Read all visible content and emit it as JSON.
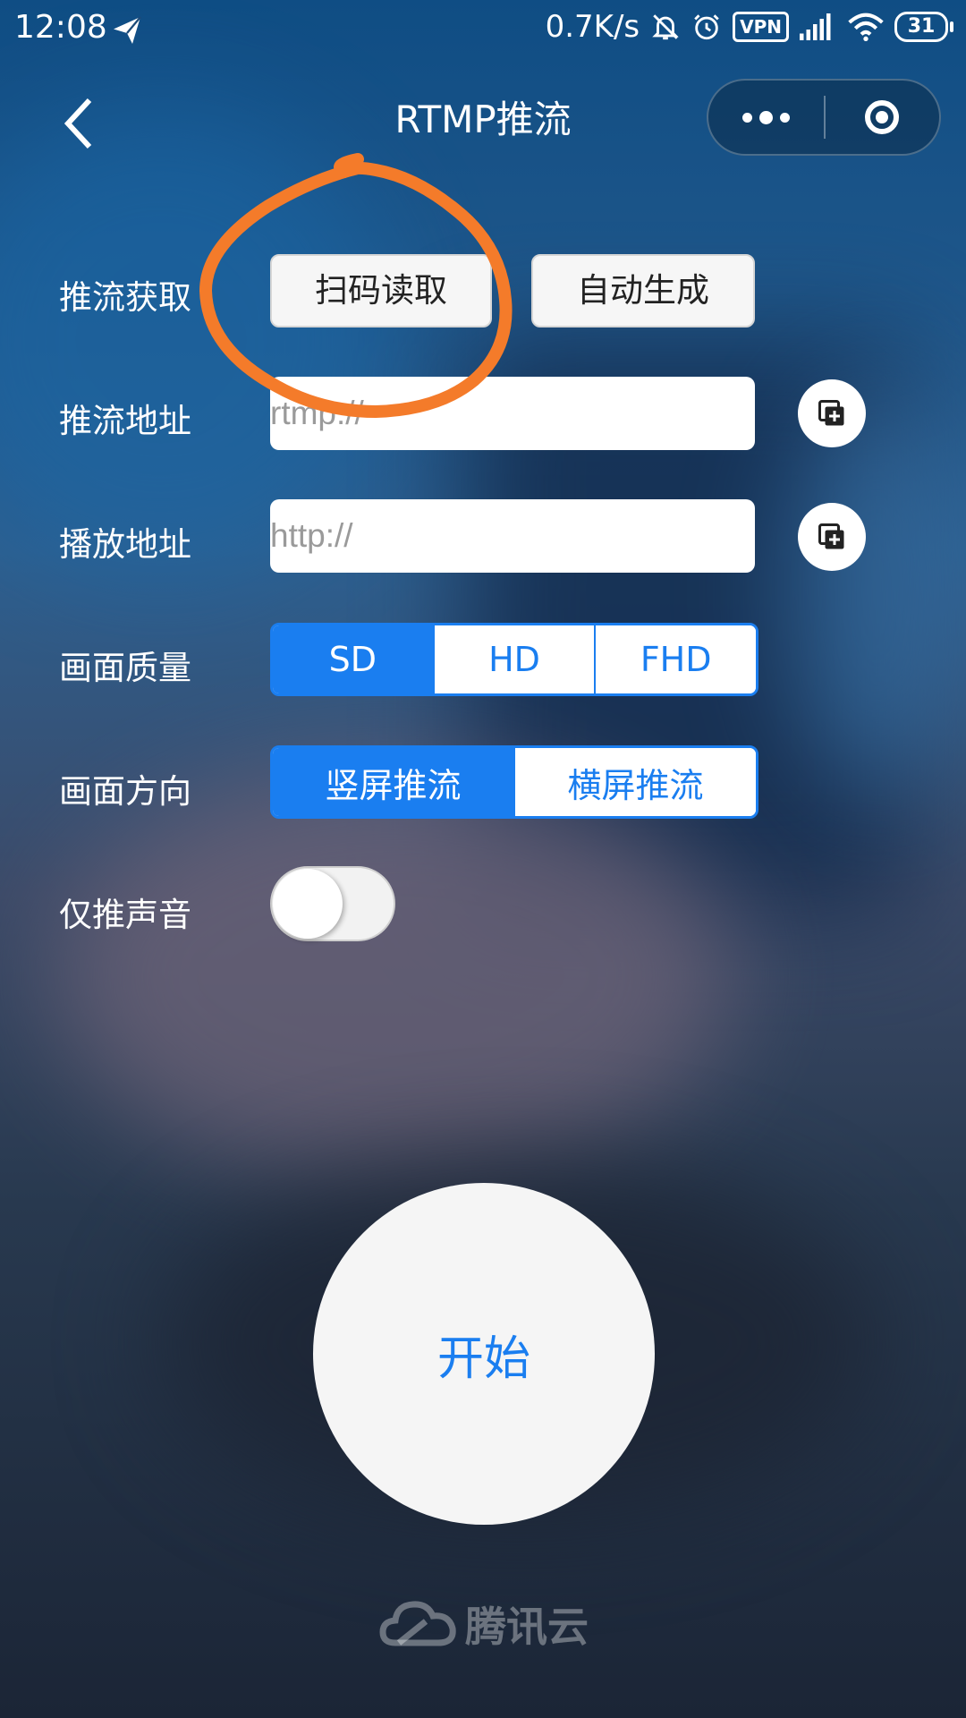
{
  "status_bar": {
    "time": "12:08",
    "network_speed": "0.7K/s",
    "vpn": "VPN",
    "battery": "31"
  },
  "nav": {
    "title": "RTMP推流"
  },
  "form": {
    "source": {
      "label": "推流获取",
      "scan_button": "扫码读取",
      "auto_button": "自动生成"
    },
    "push_url": {
      "label": "推流地址",
      "placeholder": "rtmp://"
    },
    "play_url": {
      "label": "播放地址",
      "placeholder": "http://"
    },
    "quality": {
      "label": "画面质量",
      "options": [
        "SD",
        "HD",
        "FHD"
      ],
      "selected": "SD"
    },
    "orientation": {
      "label": "画面方向",
      "options": [
        "竖屏推流",
        "横屏推流"
      ],
      "selected": "竖屏推流"
    },
    "audio_only": {
      "label": "仅推声音",
      "enabled": false
    }
  },
  "start_button": "开始",
  "footer_brand": "腾讯云",
  "colors": {
    "accent": "#1a7ef0",
    "annotation": "#f47b2a"
  }
}
